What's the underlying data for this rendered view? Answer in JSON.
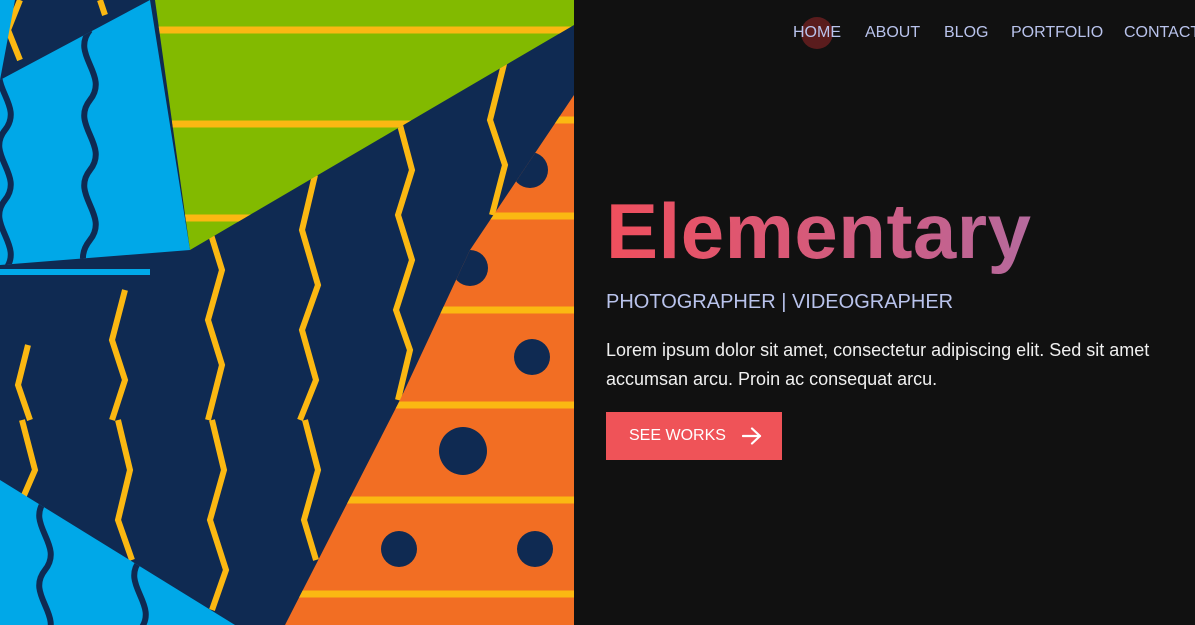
{
  "nav": {
    "items": [
      {
        "label": "HOME",
        "active": true
      },
      {
        "label": "ABOUT",
        "active": false
      },
      {
        "label": "BLOG",
        "active": false
      },
      {
        "label": "PORTFOLIO",
        "active": false
      },
      {
        "label": "CONTACT",
        "active": false
      }
    ]
  },
  "hero": {
    "title": "Elementary",
    "subtitle": "PHOTOGRAPHER | VIDEOGRAPHER",
    "text": "Lorem ipsum dolor sit amet, consectetur adipiscing elit. Sed sit amet accumsan arcu. Proin ac consequat arcu.",
    "cta_label": "SEE WORKS",
    "cta_icon": "arrow-right-icon"
  },
  "art": {
    "icon": "abstract-geometric-pattern"
  },
  "colors": {
    "background": "#111111",
    "nav_text": "#b9c3ec",
    "accent": "#ef5358",
    "title_gradient": [
      "#ef4f5d",
      "#c8608a",
      "#9a79bb"
    ],
    "art_navy": "#0f2a52",
    "art_blue": "#00a8e8",
    "art_green": "#82ba00",
    "art_orange": "#f26e23",
    "art_yellow": "#fbb812"
  }
}
